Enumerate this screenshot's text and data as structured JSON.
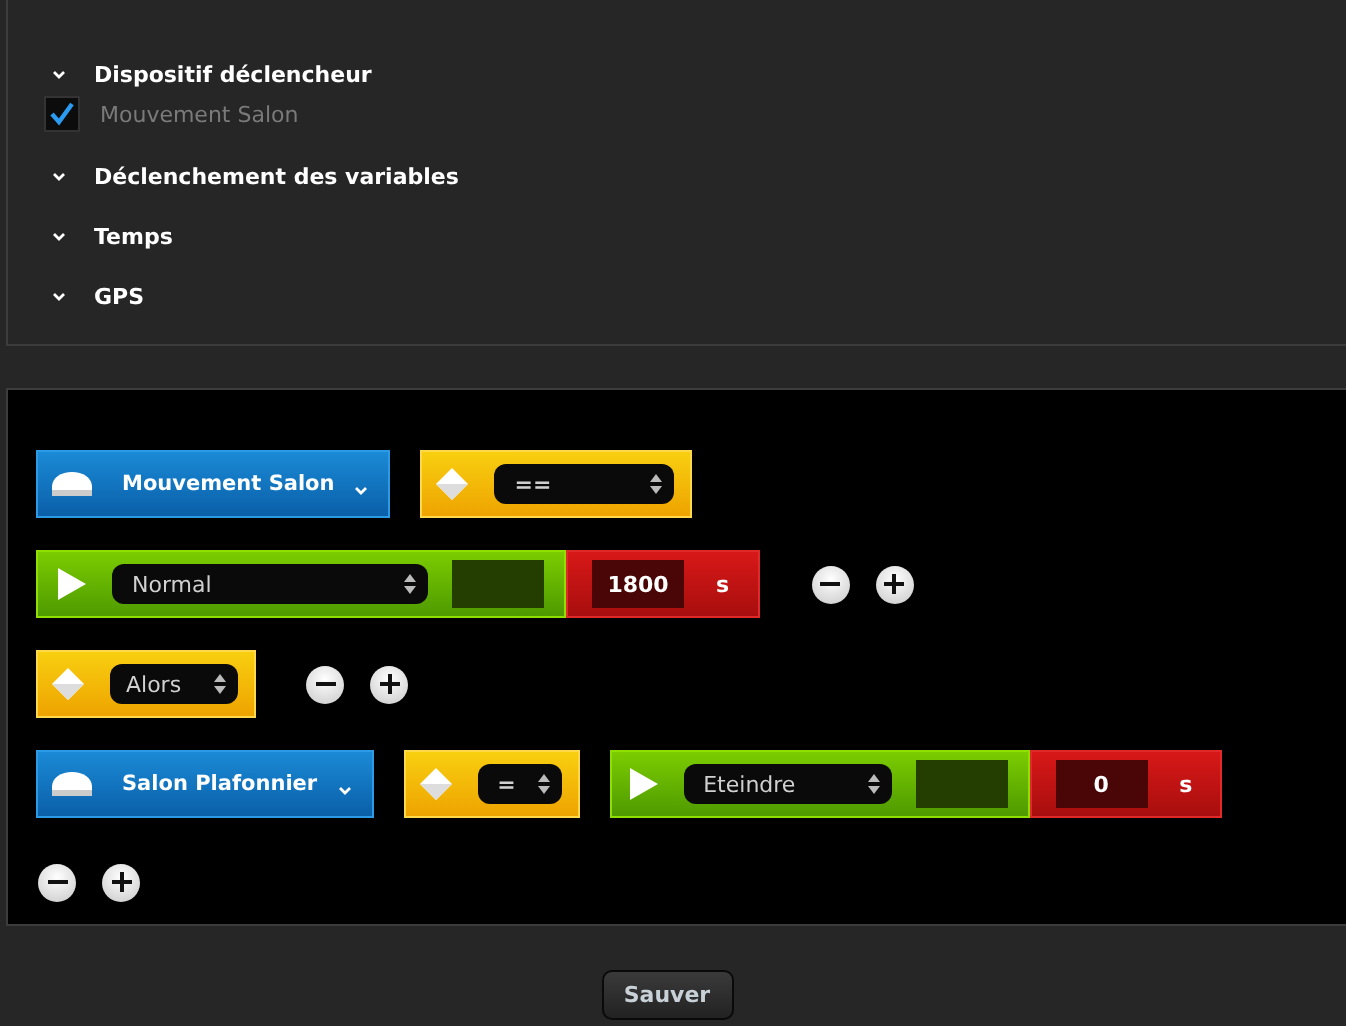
{
  "sections": [
    {
      "title": "Dispositif déclencheur",
      "items": [
        {
          "label": "Mouvement Salon",
          "checked": true
        }
      ]
    },
    {
      "title": "Déclenchement des variables"
    },
    {
      "title": "Temps"
    },
    {
      "title": "GPS"
    }
  ],
  "rules": [
    {
      "blocks": [
        {
          "kind": "device",
          "label": "Mouvement Salon"
        },
        {
          "kind": "operator",
          "value": "=="
        }
      ]
    },
    {
      "blocks": [
        {
          "kind": "action",
          "value": "Normal"
        },
        {
          "kind": "delay",
          "value": "1800",
          "unit": "s"
        },
        {
          "kind": "controls"
        }
      ]
    },
    {
      "blocks": [
        {
          "kind": "operator",
          "value": "Alors"
        },
        {
          "kind": "controls"
        }
      ]
    },
    {
      "blocks": [
        {
          "kind": "device",
          "label": "Salon Plafonnier"
        },
        {
          "kind": "operator",
          "value": "="
        },
        {
          "kind": "action",
          "value": "Eteindre"
        },
        {
          "kind": "delay",
          "value": "0",
          "unit": "s"
        }
      ]
    },
    {
      "blocks": [
        {
          "kind": "controls"
        }
      ]
    }
  ],
  "save_button": "Sauver"
}
